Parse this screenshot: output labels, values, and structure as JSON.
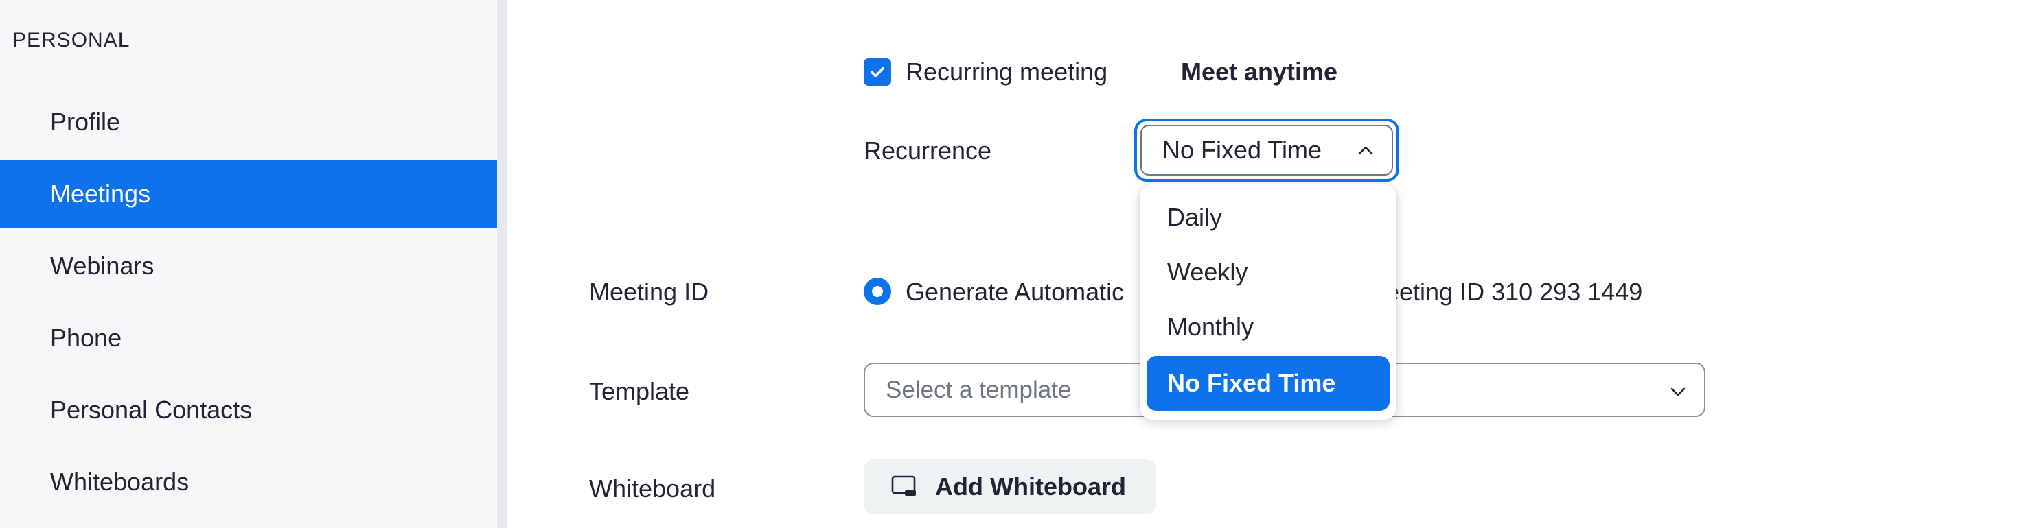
{
  "sidebar": {
    "heading": "PERSONAL",
    "items": [
      {
        "label": "Profile"
      },
      {
        "label": "Meetings"
      },
      {
        "label": "Webinars"
      },
      {
        "label": "Phone"
      },
      {
        "label": "Personal Contacts"
      },
      {
        "label": "Whiteboards"
      }
    ],
    "active_item": "Meetings"
  },
  "recurring": {
    "checkbox_label": "Recurring meeting",
    "checked": true,
    "meet_anytime": "Meet anytime"
  },
  "recurrence": {
    "label": "Recurrence",
    "selected": "No Fixed Time",
    "options": [
      "Daily",
      "Weekly",
      "Monthly",
      "No Fixed Time"
    ]
  },
  "meeting_id": {
    "label": "Meeting ID",
    "option_generate": "Generate Automatic",
    "option_personal": "leeting ID 310 293 1449",
    "selected_option": "Generate Automatically"
  },
  "template": {
    "label": "Template",
    "placeholder": "Select a template"
  },
  "whiteboard": {
    "label": "Whiteboard",
    "button_label": "Add Whiteboard"
  },
  "colors": {
    "accent": "#0e72ed",
    "sidebar_bg": "#f7f7fa",
    "text": "#232333"
  },
  "icons": {
    "checkbox": "checkmark-icon",
    "recurrence_chevron": "chevron-up-icon",
    "template_chevron": "chevron-down-icon",
    "whiteboard": "whiteboard-icon"
  }
}
